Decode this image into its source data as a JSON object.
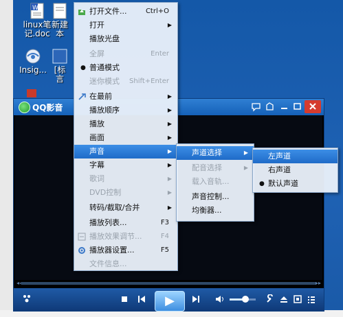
{
  "desktop": {
    "icons": [
      {
        "label": "linux笔\n记.doc",
        "icon": "word-doc-icon"
      },
      {
        "label": "新建\n本",
        "icon": "text-doc-icon"
      },
      {
        "label": "Insig...",
        "icon": "globe-app-icon"
      },
      {
        "label": "[标\n言",
        "icon": "app-icon"
      }
    ]
  },
  "player": {
    "title": "QQ影音",
    "titlebar_buttons": [
      "chat-icon",
      "skin-icon",
      "minimize-icon",
      "maximize-icon",
      "close-icon"
    ],
    "controls": [
      "tools-icon",
      "stop-icon",
      "previous-icon",
      "play-icon",
      "next-icon",
      "volume-icon",
      "wrench-icon",
      "eject-icon",
      "fullscreen-icon",
      "playlist-icon"
    ],
    "volume_level": 0.6
  },
  "main_menu": {
    "items": [
      {
        "label": "打开文件...",
        "shortcut": "Ctrl+O",
        "disabled": false,
        "submenu": false,
        "icon": "open-folder-icon"
      },
      {
        "label": "打开",
        "shortcut": "",
        "disabled": false,
        "submenu": true
      },
      {
        "label": "播放光盘",
        "shortcut": "",
        "disabled": false,
        "submenu": false
      },
      {
        "label": "全屏",
        "shortcut": "Enter",
        "disabled": true,
        "submenu": false
      },
      {
        "label": "普通模式",
        "shortcut": "",
        "disabled": false,
        "submenu": false,
        "checked": true
      },
      {
        "label": "迷你模式",
        "shortcut": "Shift+Enter",
        "disabled": true,
        "submenu": false
      },
      {
        "label": "在最前",
        "shortcut": "",
        "disabled": false,
        "submenu": true,
        "icon": "pin-icon"
      },
      {
        "label": "播放顺序",
        "shortcut": "",
        "disabled": false,
        "submenu": true
      },
      {
        "label": "播放",
        "shortcut": "",
        "disabled": false,
        "submenu": true
      },
      {
        "label": "画面",
        "shortcut": "",
        "disabled": false,
        "submenu": true
      },
      {
        "label": "声音",
        "shortcut": "",
        "disabled": false,
        "submenu": true,
        "highlighted": true
      },
      {
        "label": "字幕",
        "shortcut": "",
        "disabled": false,
        "submenu": true
      },
      {
        "label": "歌词",
        "shortcut": "",
        "disabled": true,
        "submenu": true
      },
      {
        "label": "DVD控制",
        "shortcut": "",
        "disabled": true,
        "submenu": true
      },
      {
        "label": "转码/截取/合并",
        "shortcut": "",
        "disabled": false,
        "submenu": true
      },
      {
        "label": "播放列表...",
        "shortcut": "F3",
        "disabled": false,
        "submenu": false
      },
      {
        "label": "播放效果调节...",
        "shortcut": "F4",
        "disabled": true,
        "submenu": false,
        "icon": "effects-icon"
      },
      {
        "label": "播放器设置...",
        "shortcut": "F5",
        "disabled": false,
        "submenu": false,
        "icon": "settings-icon"
      },
      {
        "label": "文件信息...",
        "shortcut": "",
        "disabled": true,
        "submenu": false
      }
    ]
  },
  "sound_menu": {
    "items": [
      {
        "label": "声道选择",
        "submenu": true,
        "highlighted": true,
        "disabled": false
      },
      {
        "label": "配音选择",
        "submenu": true,
        "disabled": true
      },
      {
        "label": "载入音轨...",
        "submenu": false,
        "disabled": true
      },
      {
        "label": "声音控制...",
        "submenu": false,
        "disabled": false
      },
      {
        "label": "均衡器...",
        "submenu": false,
        "disabled": false
      }
    ]
  },
  "channel_menu": {
    "items": [
      {
        "label": "左声道",
        "highlighted": true,
        "checked": false
      },
      {
        "label": "右声道",
        "highlighted": false,
        "checked": false
      },
      {
        "label": "默认声道",
        "highlighted": false,
        "checked": true
      }
    ]
  }
}
